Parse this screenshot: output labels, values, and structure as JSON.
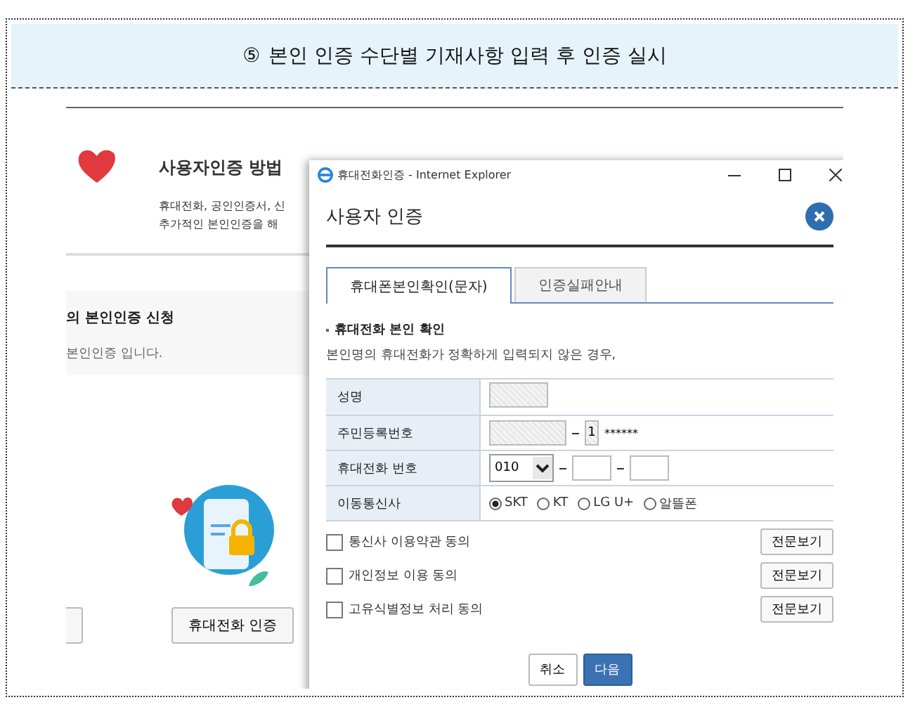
{
  "banner": {
    "step": "⑤",
    "title": "본인 인증 수단별 기재사항 입력 후 인증 실시"
  },
  "background_page": {
    "heading": "사용자인증 방법",
    "description_lines": [
      "휴대전화, 공인인증서, 신",
      "추가적인 본인인증을 해"
    ],
    "section_title": "의 본인인증 신청",
    "section_text": "본인인증 입니다.",
    "phone_auth_button": "휴대전화 인증"
  },
  "popup": {
    "window_title": "휴대전화인증 - Internet Explorer",
    "dialog_title": "사용자 인증",
    "tabs": [
      {
        "label": "휴대폰본인확인(문자)",
        "selected": true
      },
      {
        "label": "인증실패안내",
        "selected": false
      }
    ],
    "section_title": "휴대전화 본인 확인",
    "section_note": "본인명의 휴대전화가 정확하게 입력되지 않은 경우,",
    "form": {
      "name_label": "성명",
      "rrn_label": "주민등록번호",
      "rrn_back_first": "1",
      "rrn_mask": "******",
      "phone_label": "휴대전화 번호",
      "phone_prefix": "010",
      "carrier_label": "이동통신사",
      "carriers": [
        {
          "label": "SKT",
          "selected": true
        },
        {
          "label": "KT",
          "selected": false
        },
        {
          "label": "LG U+",
          "selected": false
        },
        {
          "label": "알뜰폰",
          "selected": false
        }
      ]
    },
    "agreements": [
      {
        "label": "통신사 이용약관 동의",
        "checked": false,
        "button": "전문보기"
      },
      {
        "label": "개인정보 이용 동의",
        "checked": false,
        "button": "전문보기"
      },
      {
        "label": "고유식별정보 처리 동의",
        "checked": false,
        "button": "전문보기"
      }
    ],
    "cancel_button": "취소",
    "next_button": "다음"
  }
}
